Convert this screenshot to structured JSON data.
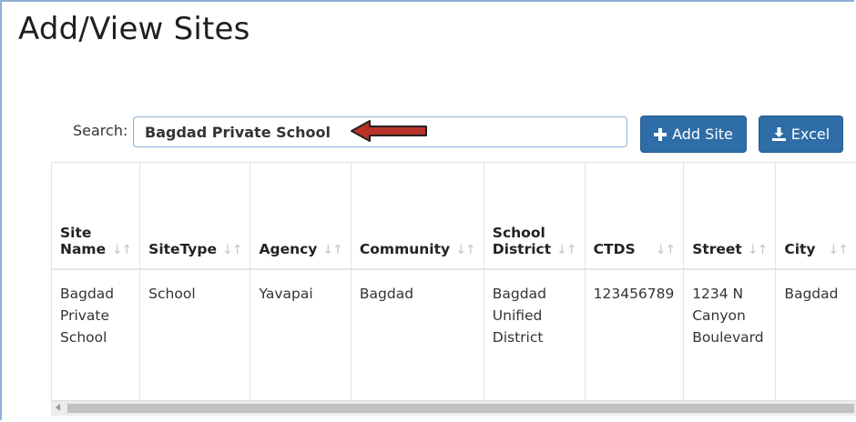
{
  "page": {
    "title": "Add/View Sites"
  },
  "search": {
    "label": "Search:",
    "value": "Bagdad Private School"
  },
  "toolbar": {
    "add_label": "Add Site",
    "excel_label": "Excel"
  },
  "table": {
    "headers": [
      {
        "line1": "Site",
        "line2": "Name"
      },
      {
        "line1": "",
        "line2": "SiteType"
      },
      {
        "line1": "",
        "line2": "Agency"
      },
      {
        "line1": "",
        "line2": "Community"
      },
      {
        "line1": "School",
        "line2": "District"
      },
      {
        "line1": "",
        "line2": "CTDS"
      },
      {
        "line1": "",
        "line2": "Street"
      },
      {
        "line1": "",
        "line2": "City"
      }
    ],
    "rows": [
      [
        "Bagdad Private School",
        "School",
        "Yavapai",
        "Bagdad",
        "Bagdad Unified District",
        "123456789",
        "1234 N Canyon Boulevard",
        "Bagdad"
      ]
    ]
  },
  "colors": {
    "primary_button": "#2e6da7",
    "arrow": "#b8322a"
  }
}
